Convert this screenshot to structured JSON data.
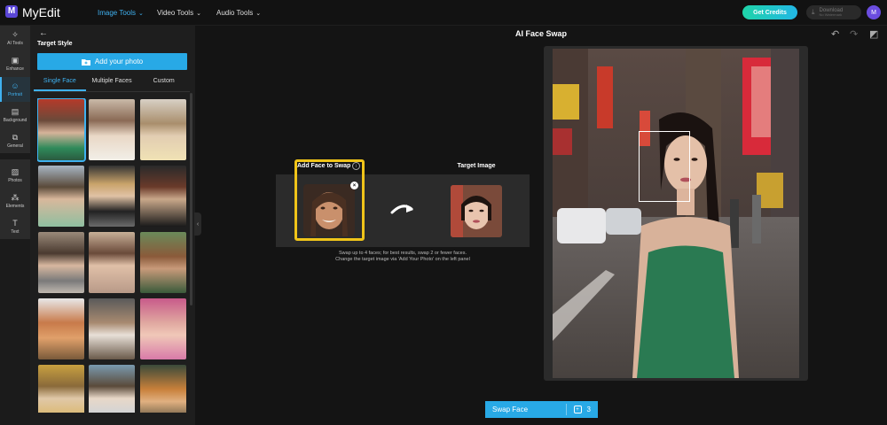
{
  "header": {
    "logo_letter": "M",
    "brand": "MyEdit",
    "nav": [
      {
        "label": "Image Tools",
        "active": true
      },
      {
        "label": "Video Tools",
        "active": false
      },
      {
        "label": "Audio Tools",
        "active": false
      }
    ],
    "credits_label": "Get Credits",
    "download_label": "Download",
    "download_sub": "No Watermark",
    "avatar_letter": "M"
  },
  "rail": [
    {
      "label": "AI Tools",
      "icon": "magic-wand-icon",
      "glyph": "✧"
    },
    {
      "label": "Enhance",
      "icon": "image-enhance-icon",
      "glyph": "▣"
    },
    {
      "label": "Portrait",
      "icon": "portrait-icon",
      "glyph": "☺",
      "active": true
    },
    {
      "label": "Background",
      "icon": "background-icon",
      "glyph": "▤"
    },
    {
      "label": "General",
      "icon": "crop-icon",
      "glyph": "⧉"
    },
    {
      "label": "Photos",
      "icon": "photos-icon",
      "glyph": "▨"
    },
    {
      "label": "Elements",
      "icon": "elements-icon",
      "glyph": "⁂"
    },
    {
      "label": "Text",
      "icon": "text-icon",
      "glyph": "T"
    }
  ],
  "panel": {
    "title": "Target Style",
    "add_photo": "Add your photo",
    "tabs": [
      "Single Face",
      "Multiple Faces",
      "Custom"
    ]
  },
  "main": {
    "title": "AI Face Swap",
    "add_face_label": "Add Face to Swap",
    "target_label": "Target Image",
    "hint_lines": [
      "Swap up to 4 faces; for best results, swap 2 or fewer faces.",
      "Change the target image via 'Add Your Photo' on the left panel"
    ],
    "swap_label": "Swap Face",
    "swap_cost": "3"
  }
}
